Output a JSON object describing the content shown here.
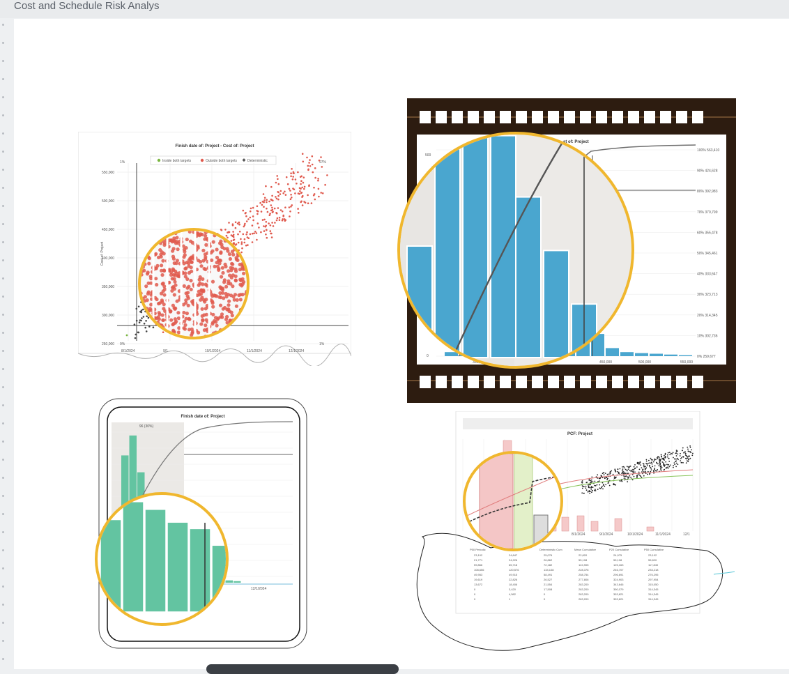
{
  "window": {
    "title": "Cost and Schedule Risk Analys"
  },
  "colors": {
    "accent_ring": "#f0b72e",
    "scatter_red": "#e05a4e",
    "hist_blue": "#4aa6cf",
    "hist_green": "#63c4a1",
    "film": "#2d1c10"
  },
  "scatter_chart": {
    "title": "Finish date of: Project - Cost of: Project",
    "legend": [
      "Inside both targets",
      "Outside both targets",
      "Deterministic"
    ],
    "y_axis_label": "Cost of: Project",
    "y_ticks": [
      "550,000",
      "500,000",
      "450,000",
      "400,000",
      "350,000",
      "300,000",
      "250,000"
    ],
    "x_ticks": [
      "8/1/2024",
      "9/1",
      "10/1/2024",
      "11/1/2024",
      "12/1/2024"
    ],
    "corner_labels": {
      "top_left": "1%",
      "top_right": "97%",
      "bottom_left": "0%",
      "bottom_right": "1%"
    }
  },
  "histogram_blue": {
    "title_fragment": "st of: Project",
    "left_tick_top": "500",
    "left_tick_bottom": "0",
    "right_ticks": [
      "100% 563,410",
      "90% 424,628",
      "80% 392,983",
      "70% 370,799",
      "60% 355,478",
      "50% 345,461",
      "40% 333,647",
      "30% 323,713",
      "20% 314,345",
      "10% 302,736",
      "0% 259,677"
    ],
    "x_ticks": [
      "300,0",
      "450,000",
      "500,000",
      "550,000"
    ]
  },
  "histogram_green": {
    "title": "Finish date of: Project",
    "highlight_label": "96 (30%)",
    "x_tick": "12/1/2024"
  },
  "pcf_chart": {
    "title": "PCF: Project",
    "x_ticks": [
      "8/1/2024",
      "9/1/2024",
      "10/1/2024",
      "11/1/2024",
      "12/1"
    ],
    "table_headers": [
      "P50 Periodic",
      "P90 Periodic",
      "Deterministic Cum",
      "Mean Cumulative",
      "P20 Cumulative",
      "P50 Cumulative"
    ],
    "table_rows": [
      [
        "23,102",
        "24,847",
        "25,076",
        "22,820",
        "24,975",
        "23,102"
      ],
      [
        "21,771",
        "24,226",
        "26,862",
        "55,108",
        "55,108",
        "55,820"
      ],
      [
        "59,866",
        "65,718",
        "72,182",
        "124,905",
        "125,163",
        "117,840"
      ],
      [
        "108,656",
        "120,576",
        "134,108",
        "228,376",
        "246,707",
        "233,218"
      ],
      [
        "49,953",
        "49,915",
        "58,491",
        "258,754",
        "296,691",
        "276,295"
      ],
      [
        "19,619",
        "22,826",
        "26,527",
        "277,806",
        "324,903",
        "297,954"
      ],
      [
        "13,672",
        "18,406",
        "21,554",
        "283,200",
        "343,646",
        "315,050"
      ],
      [
        "0",
        "3,420",
        "17,508",
        "283,200",
        "350,079",
        "314,345"
      ],
      [
        "0",
        "4,582",
        "0",
        "283,200",
        "353,821",
        "314,345"
      ],
      [
        "0",
        "1",
        "0",
        "283,200",
        "353,821",
        "314,345"
      ]
    ]
  }
}
